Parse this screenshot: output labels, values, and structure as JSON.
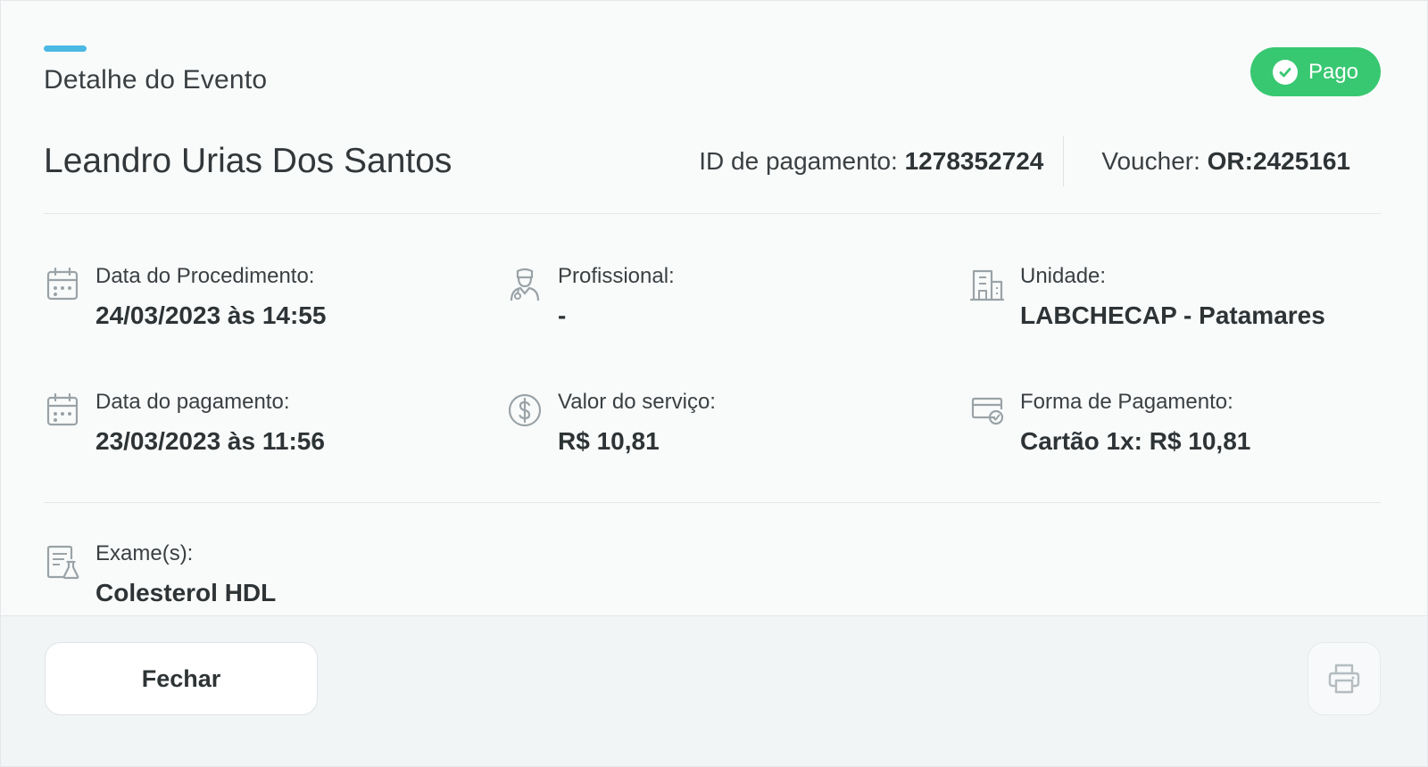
{
  "modal": {
    "title": "Detalhe do Evento",
    "status": "Pago",
    "colors": {
      "accent": "#4cb8e4",
      "status": "#38c871"
    }
  },
  "patient": {
    "name": "Leandro Urias Dos Santos",
    "payment_id_label": "ID de pagamento:",
    "payment_id_value": "1278352724",
    "voucher_label": "Voucher:",
    "voucher_value": "OR:2425161"
  },
  "details": {
    "procedure_date": {
      "label": "Data do Procedimento:",
      "value": "24/03/2023 às 14:55",
      "icon": "calendar-icon"
    },
    "professional": {
      "label": "Profissional:",
      "value": "-",
      "icon": "doctor-icon"
    },
    "unit": {
      "label": "Unidade:",
      "value": "LABCHECAP - Patamares",
      "icon": "building-icon"
    },
    "payment_date": {
      "label": "Data do pagamento:",
      "value": "23/03/2023 às 11:56",
      "icon": "calendar-icon"
    },
    "service_value": {
      "label": "Valor do serviço:",
      "value": "R$ 10,81",
      "icon": "dollar-icon"
    },
    "payment_method": {
      "label": "Forma de Pagamento:",
      "value": "Cartão 1x: R$ 10,81",
      "icon": "card-check-icon"
    },
    "exams": {
      "label": "Exame(s):",
      "value": "Colesterol HDL",
      "icon": "lab-report-icon"
    }
  },
  "footer": {
    "close_label": "Fechar",
    "print_icon": "printer-icon"
  }
}
